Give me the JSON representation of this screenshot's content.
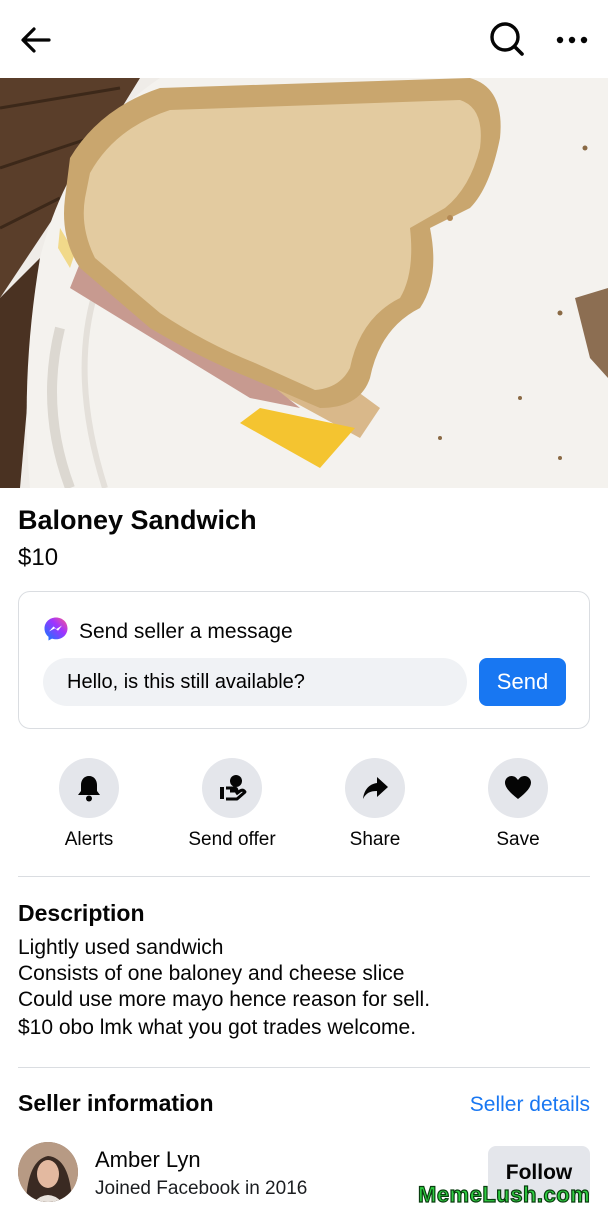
{
  "topbar": {
    "back_icon": "arrow-left-icon",
    "search_icon": "search-icon",
    "more_icon": "more-dots-icon"
  },
  "listing": {
    "title": "Baloney Sandwich",
    "price": "$10"
  },
  "message": {
    "title": "Send seller a message",
    "input_value": "Hello, is this still available?",
    "send_label": "Send",
    "icon": "messenger-icon"
  },
  "actions": [
    {
      "label": "Alerts",
      "icon": "bell-icon"
    },
    {
      "label": "Send offer",
      "icon": "offer-icon"
    },
    {
      "label": "Share",
      "icon": "share-arrow-icon"
    },
    {
      "label": "Save",
      "icon": "heart-icon"
    }
  ],
  "description": {
    "heading": "Description",
    "lines": [
      "Lightly used sandwich",
      "Consists of one baloney and cheese slice",
      "Could use more mayo hence reason for sell.",
      "$10 obo lmk what you got trades welcome."
    ]
  },
  "seller": {
    "heading": "Seller information",
    "details_link": "Seller details",
    "name": "Amber Lyn",
    "joined": "Joined Facebook in 2016",
    "follow_label": "Follow"
  },
  "watermark": "MemeLush.com",
  "colors": {
    "accent": "#1877f2",
    "button_gray": "#e4e6eb",
    "input_gray": "#f0f2f5"
  }
}
